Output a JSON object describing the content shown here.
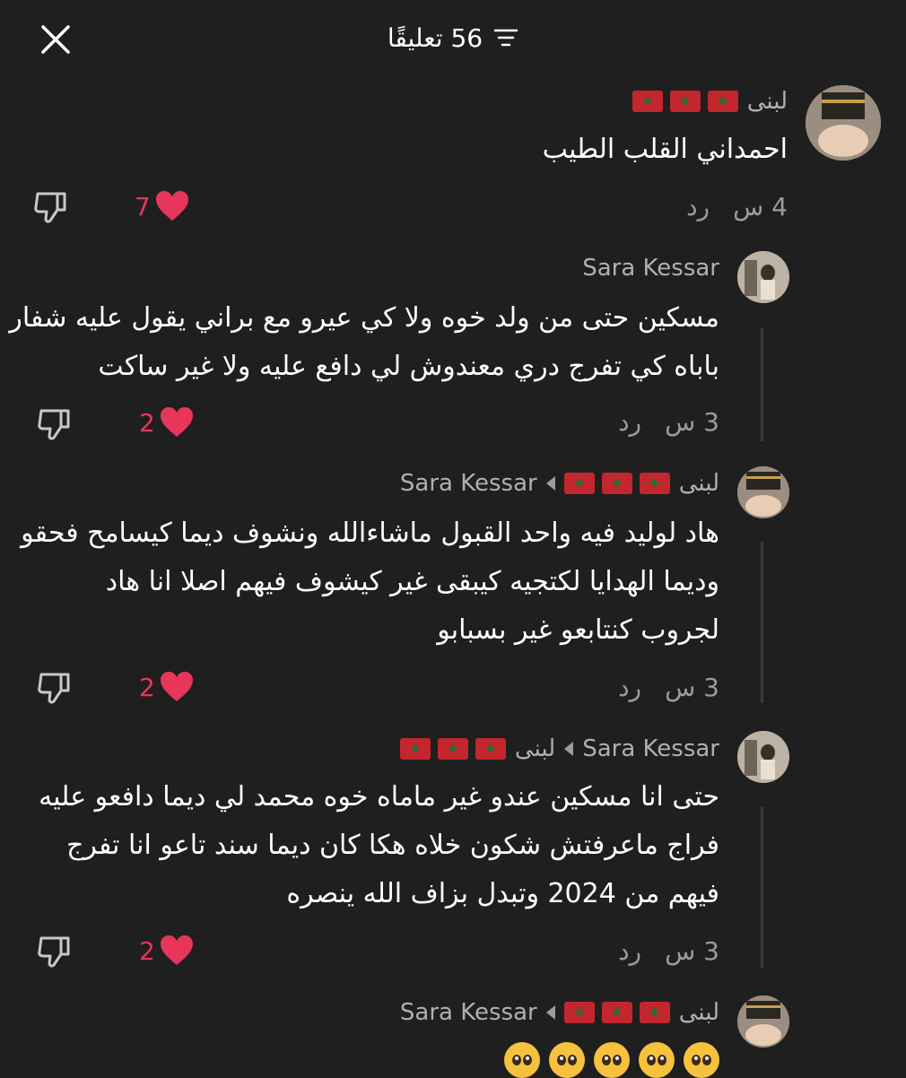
{
  "header": {
    "title": "56 تعليقًا"
  },
  "comments": [
    {
      "author": "لبنى",
      "text_lines": [
        "احمداني القلب الطيب"
      ],
      "time": "4 س",
      "reply": "رد",
      "likes": "7"
    },
    {
      "author": "Sara Kessar",
      "text_lines": [
        "مسكين حتى من ولد خوه ولا كي عيرو مع براني يقول عليه شفار",
        "باباه كي تفرج دري معندوش لي دافع عليه ولا غير ساكت"
      ],
      "time": "3 س",
      "reply": "رد",
      "likes": "2"
    },
    {
      "author": "لبنى",
      "reply_to": "Sara Kessar",
      "text_lines": [
        "هاد لوليد فيه واحد القبول ماشاءالله ونشوف ديما كيسامح فحقو",
        "وديما الهدايا لكتجيه كيبقى غير كيشوف فيهم اصلا انا هاد",
        "لجروب كنتابعو غير بسبابو"
      ],
      "time": "3 س",
      "reply": "رد",
      "likes": "2"
    },
    {
      "author": "Sara Kessar",
      "reply_to": "لبنى",
      "text_lines": [
        "حتى انا مسكين عندو غير ماماه خوه محمد لي ديما دافعو عليه",
        "فراج ماعرفتش شكون خلاه هكا كان ديما سند تاعو انا تفرج",
        "فيهم من 2024 وتبدل بزاف الله ينصره"
      ],
      "time": "3 س",
      "reply": "رد",
      "likes": "2"
    },
    {
      "author": "لبنى",
      "reply_to": "Sara Kessar",
      "text_lines": [
        "🥺🥺🥺🥺🥺"
      ]
    }
  ],
  "colors": {
    "background": "#1f1f1f",
    "like": "#e8365a",
    "muted": "#9b9b9b"
  }
}
